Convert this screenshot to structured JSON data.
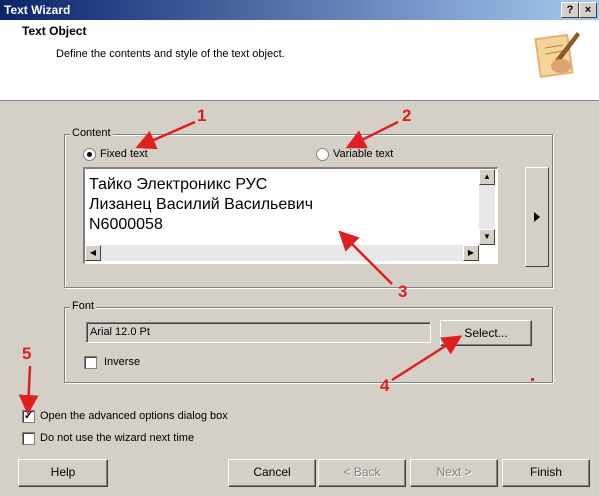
{
  "window": {
    "title": "Text Wizard",
    "help_button": "?",
    "close_button": "×"
  },
  "header": {
    "title": "Text Object",
    "description": "Define the contents and style of the text object.",
    "image_icon": "hand-writing-icon"
  },
  "content_group": {
    "label": "Content",
    "fixed_text_label": "Fixed text",
    "variable_text_label": "Variable text",
    "selected": "Fixed text",
    "text_lines": [
      "Тайко Электроникс РУС",
      "Лизанец Василий Васильевич",
      "N6000058"
    ],
    "expand_icon": "arrow-right-icon"
  },
  "font_group": {
    "label": "Font",
    "value": "Arial 12.0 Pt",
    "select_button": "Select...",
    "inverse_label": "Inverse",
    "inverse_checked": false
  },
  "options": {
    "advanced_label": "Open the advanced options dialog box",
    "advanced_checked": true,
    "no_wizard_label": "Do not use the wizard next time",
    "no_wizard_checked": false
  },
  "buttons": {
    "help": "Help",
    "cancel": "Cancel",
    "back": "< Back",
    "next": "Next >",
    "finish": "Finish"
  },
  "annotations": [
    "1",
    "2",
    "3",
    "4",
    "5"
  ],
  "annotation_color": "#e02020"
}
